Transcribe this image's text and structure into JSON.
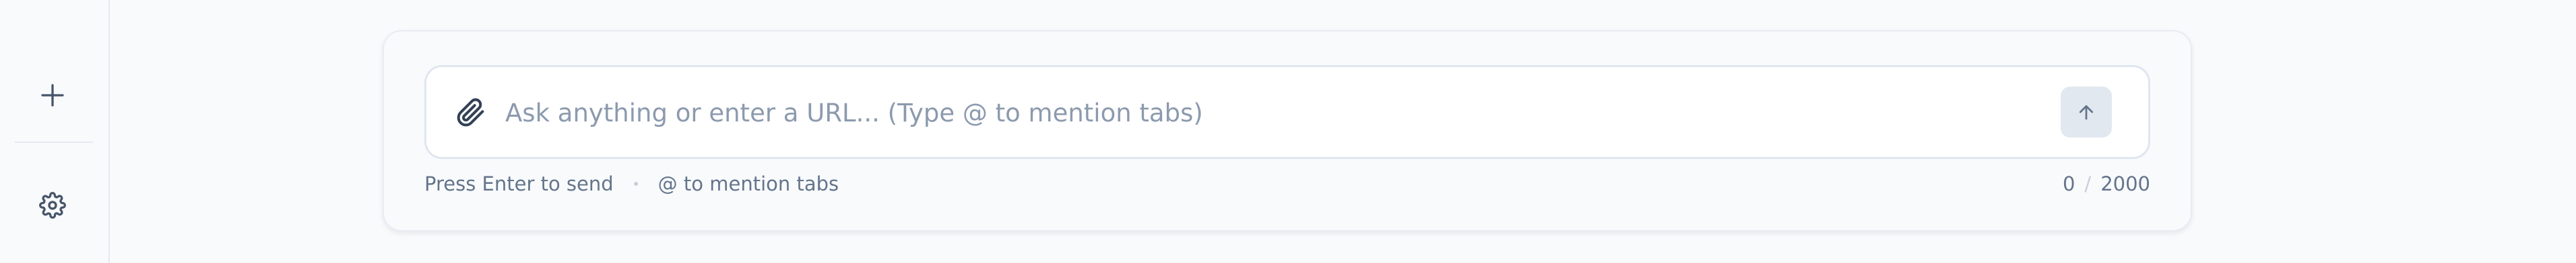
{
  "sidebar": {
    "new_icon": "plus-icon",
    "settings_icon": "gear-icon"
  },
  "composer": {
    "attach_icon": "paperclip-icon",
    "placeholder": "Ask anything or enter a URL... (Type @ to mention tabs)",
    "value": "",
    "send_icon": "arrow-up-icon"
  },
  "hints": {
    "send": "Press Enter to send",
    "mention": "@ to mention tabs"
  },
  "counter": {
    "current": "0",
    "separator": "/",
    "max": "2000"
  },
  "colors": {
    "background": "#f8fafc",
    "icon": "#475569",
    "placeholder": "#8c9aae",
    "send_button": "#e2e8f0"
  }
}
